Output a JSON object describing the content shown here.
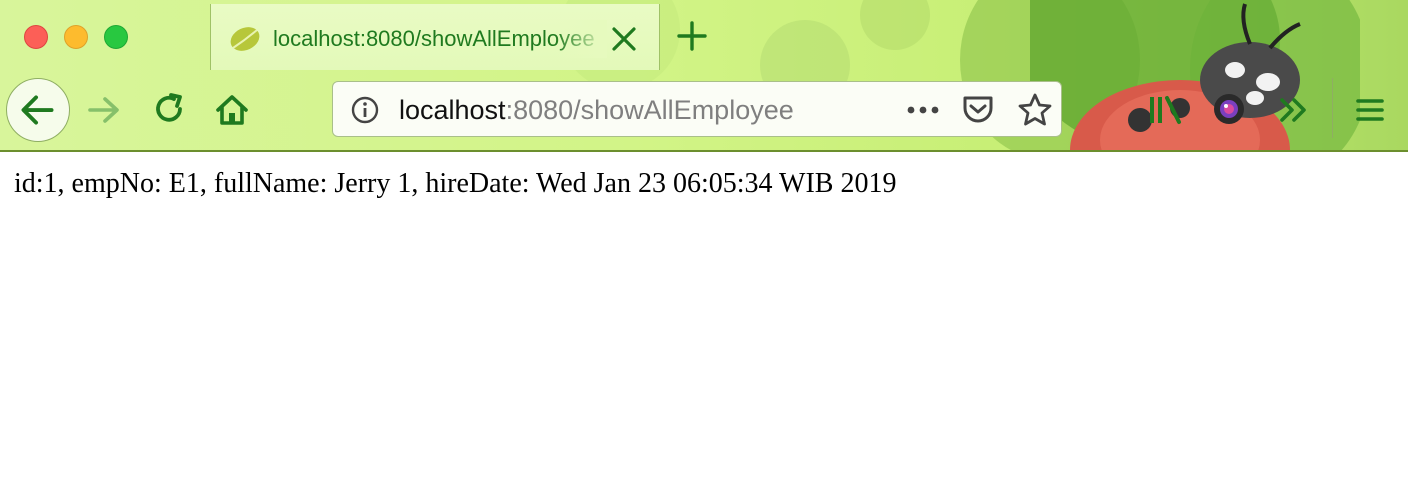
{
  "window": {
    "traffic_lights": [
      "close",
      "minimize",
      "maximize"
    ]
  },
  "tab": {
    "title": "localhost:8080/showAllEmployee",
    "favicon": "spring-leaf-icon"
  },
  "toolbar": {
    "back_icon": "arrow-left-icon",
    "forward_icon": "arrow-right-icon",
    "reload_icon": "reload-icon",
    "home_icon": "home-icon",
    "library_icon": "library-icon",
    "extension_icon": "camera-lens-icon",
    "overflow_icon": "double-chevron-right-icon",
    "menu_icon": "hamburger-menu-icon"
  },
  "urlbar": {
    "host": "localhost",
    "rest": ":8080/showAllEmployee",
    "info_icon": "info-icon",
    "actions_icon": "more-dots-icon",
    "pocket_icon": "pocket-icon",
    "bookmark_icon": "star-icon"
  },
  "page": {
    "text": "id:1, empNo: E1, fullName: Jerry 1, hireDate: Wed Jan 23 06:05:34 WIB 2019"
  },
  "theme": {
    "accent": "#1f8a1f",
    "chrome_background": "#d2f487"
  }
}
